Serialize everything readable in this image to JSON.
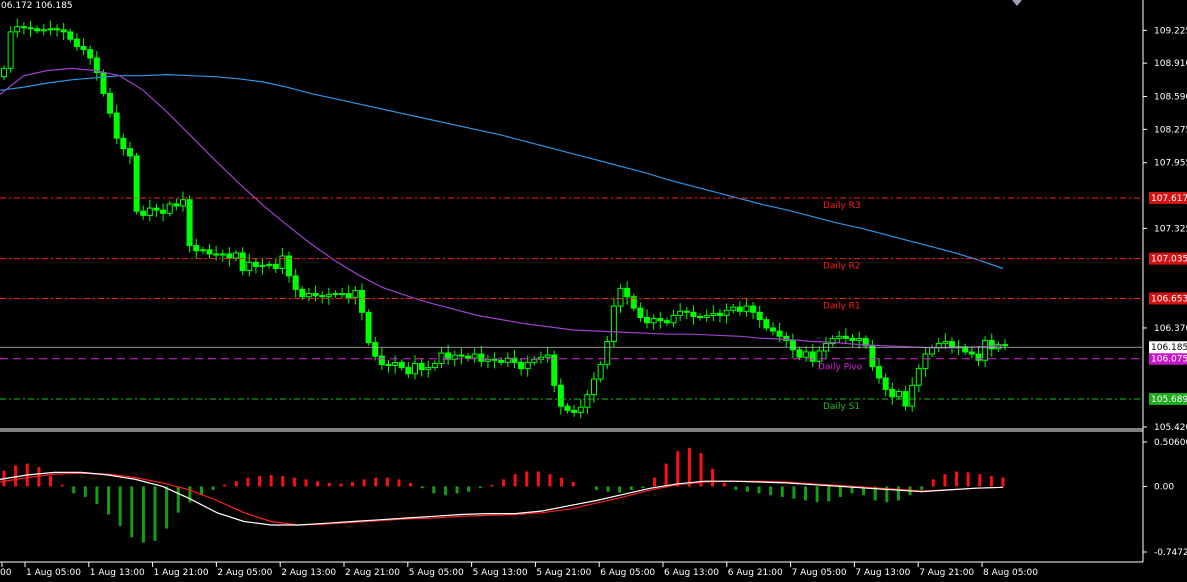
{
  "header": {
    "text": "06.172 106.185"
  },
  "price_axis": {
    "ticks": [
      "109.225",
      "108.910",
      "108.590",
      "108.275",
      "107.955",
      "107.325",
      "106.370",
      "105.420"
    ],
    "levels": [
      {
        "key": "R3",
        "label": "Daily R3",
        "tag": "107.617",
        "value": 107.617,
        "color": "#ff2020",
        "tag_bg": "#d01414",
        "tag_fg": "#ffffff"
      },
      {
        "key": "R2",
        "label": "Daily R2",
        "tag": "107.035",
        "value": 107.035,
        "color": "#ff2020",
        "tag_bg": "#d01414",
        "tag_fg": "#ffffff"
      },
      {
        "key": "R1",
        "label": "Daily R1",
        "tag": "106.653",
        "value": 106.653,
        "color": "#ff2020",
        "tag_bg": "#d01414",
        "tag_fg": "#ffffff"
      },
      {
        "key": "Pivot",
        "label": "Daily Pivo",
        "tag": "106.075",
        "value": 106.075,
        "color": "#e020e0",
        "tag_bg": "#c818c8",
        "tag_fg": "#ffffff"
      },
      {
        "key": "S1",
        "label": "Daily S1",
        "tag": "105.689",
        "value": 105.689,
        "color": "#20c020",
        "tag_bg": "#1faa1f",
        "tag_fg": "#ffffff"
      }
    ],
    "bid_tag": "106.185",
    "bid_value": 106.185
  },
  "osc_axis": {
    "ticks": [
      "0.50606",
      "0.00",
      "-0.74721"
    ]
  },
  "time_axis": {
    "labels": [
      "00",
      "1 Aug 05:00",
      "1 Aug 13:00",
      "1 Aug 21:00",
      "2 Aug 05:00",
      "2 Aug 13:00",
      "2 Aug 21:00",
      "5 Aug 05:00",
      "5 Aug 13:00",
      "5 Aug 21:00",
      "6 Aug 05:00",
      "6 Aug 13:00",
      "6 Aug 21:00",
      "7 Aug 05:00",
      "7 Aug 13:00",
      "7 Aug 21:00",
      "8 Aug 05:00"
    ]
  },
  "colors": {
    "candle": "#00ff00",
    "ma_slow": "#2e95e6",
    "ma_fast": "#a040d0",
    "hist_up": "#ff1010",
    "hist_down": "#10a010",
    "macd_main": "#ffffff",
    "macd_signal": "#ff2020"
  },
  "chart_data": {
    "type": "candlestick",
    "symbol_quote": "106.185",
    "y_range": [
      105.42,
      109.42
    ],
    "osc_range": [
      -0.74721,
      0.50606
    ],
    "close": [
      108.86,
      109.21,
      109.26,
      109.25,
      109.24,
      109.22,
      109.23,
      109.24,
      109.23,
      109.21,
      109.14,
      109.07,
      109.04,
      108.96,
      108.82,
      108.62,
      108.43,
      108.19,
      108.09,
      108.02,
      107.49,
      107.45,
      107.52,
      107.5,
      107.47,
      107.56,
      107.54,
      107.6,
      107.16,
      107.11,
      107.12,
      107.08,
      107.07,
      107.08,
      107.04,
      107.09,
      106.92,
      107.0,
      106.96,
      106.97,
      106.98,
      106.94,
      107.06,
      106.87,
      106.74,
      106.67,
      106.7,
      106.68,
      106.67,
      106.69,
      106.7,
      106.7,
      106.66,
      106.73,
      106.52,
      106.23,
      106.1,
      106.02,
      106.01,
      106.04,
      105.99,
      105.93,
      106.03,
      105.97,
      105.99,
      106.03,
      106.13,
      106.07,
      106.11,
      106.1,
      106.08,
      106.12,
      106.05,
      106.07,
      106.06,
      106.04,
      106.08,
      106.04,
      105.98,
      106.04,
      106.07,
      106.09,
      106.11,
      105.82,
      105.62,
      105.58,
      105.56,
      105.61,
      105.73,
      105.88,
      106.02,
      106.24,
      106.58,
      106.75,
      106.67,
      106.56,
      106.47,
      106.42,
      106.46,
      106.44,
      106.42,
      106.49,
      106.53,
      106.52,
      106.48,
      106.47,
      106.49,
      106.51,
      106.49,
      106.54,
      106.57,
      106.53,
      106.58,
      106.52,
      106.45,
      106.37,
      106.34,
      106.29,
      106.25,
      106.16,
      106.09,
      106.14,
      106.05,
      106.15,
      106.22,
      106.27,
      106.29,
      106.27,
      106.25,
      106.27,
      106.2,
      106.0,
      105.89,
      105.78,
      105.71,
      105.76,
      105.62,
      105.82,
      105.98,
      106.12,
      106.18,
      106.22,
      106.24,
      106.19,
      106.19,
      106.14,
      106.12,
      106.06,
      106.25,
      106.17,
      106.21,
      106.2
    ],
    "ma_slow": [
      108.65,
      108.68,
      108.72,
      108.75,
      108.77,
      108.79,
      108.79,
      108.8,
      108.79,
      108.78,
      108.76,
      108.73,
      108.68,
      108.62,
      108.57,
      108.52,
      108.47,
      108.42,
      108.37,
      108.32,
      108.27,
      108.22,
      108.16,
      108.1,
      108.04,
      107.98,
      107.92,
      107.86,
      107.79,
      107.73,
      107.67,
      107.61,
      107.55,
      107.5,
      107.44,
      107.38,
      107.33,
      107.27,
      107.21,
      107.15,
      107.09,
      107.02,
      106.94
    ],
    "ma_fast": [
      108.61,
      108.79,
      108.84,
      108.86,
      108.84,
      108.79,
      108.65,
      108.44,
      108.21,
      107.98,
      107.76,
      107.55,
      107.36,
      107.18,
      107.02,
      106.88,
      106.76,
      106.68,
      106.61,
      106.55,
      106.49,
      106.45,
      106.41,
      106.38,
      106.35,
      106.34,
      106.33,
      106.32,
      106.31,
      106.31,
      106.3,
      106.29,
      106.27,
      106.26,
      106.24,
      106.23,
      106.21,
      106.2,
      106.19,
      106.18,
      106.18,
      106.19,
      106.2
    ],
    "macd_hist": [
      0.18,
      0.24,
      0.26,
      0.22,
      0.12,
      0.02,
      -0.08,
      -0.12,
      -0.2,
      -0.32,
      -0.45,
      -0.58,
      -0.64,
      -0.62,
      -0.48,
      -0.3,
      -0.18,
      -0.1,
      -0.04,
      0.02,
      0.06,
      0.1,
      0.12,
      0.13,
      0.12,
      0.1,
      0.08,
      0.06,
      0.04,
      0.03,
      0.05,
      0.08,
      0.1,
      0.1,
      0.08,
      0.04,
      -0.02,
      -0.08,
      -0.1,
      -0.08,
      -0.06,
      -0.02,
      0.02,
      0.08,
      0.14,
      0.17,
      0.17,
      0.14,
      0.1,
      0.05,
      0.0,
      -0.04,
      -0.06,
      -0.07,
      -0.04,
      -0.02,
      0.1,
      0.26,
      0.4,
      0.44,
      0.38,
      0.2,
      0.04,
      -0.04,
      -0.06,
      -0.08,
      -0.1,
      -0.12,
      -0.14,
      -0.16,
      -0.18,
      -0.17,
      -0.12,
      -0.08,
      -0.1,
      -0.16,
      -0.18,
      -0.16,
      -0.1,
      -0.04,
      0.08,
      0.14,
      0.17,
      0.16,
      0.14,
      0.12,
      0.1
    ],
    "macd_main": [
      0.08,
      0.13,
      0.16,
      0.16,
      0.13,
      0.08,
      0.0,
      -0.14,
      -0.3,
      -0.4,
      -0.44,
      -0.44,
      -0.42,
      -0.4,
      -0.38,
      -0.36,
      -0.34,
      -0.32,
      -0.31,
      -0.31,
      -0.28,
      -0.22,
      -0.16,
      -0.09,
      -0.02,
      0.03,
      0.06,
      0.06,
      0.05,
      0.04,
      0.02,
      0.0,
      -0.02,
      -0.04,
      -0.06,
      -0.04,
      -0.02,
      -0.01
    ],
    "macd_signal": [
      0.05,
      0.1,
      0.14,
      0.15,
      0.14,
      0.1,
      0.04,
      -0.04,
      -0.16,
      -0.3,
      -0.4,
      -0.44,
      -0.43,
      -0.41,
      -0.39,
      -0.37,
      -0.36,
      -0.34,
      -0.33,
      -0.32,
      -0.3,
      -0.26,
      -0.19,
      -0.12,
      -0.04,
      0.02,
      0.05,
      0.06,
      0.06,
      0.05,
      0.03,
      0.01,
      -0.01,
      -0.03,
      -0.05,
      -0.04,
      -0.02,
      -0.01
    ]
  }
}
